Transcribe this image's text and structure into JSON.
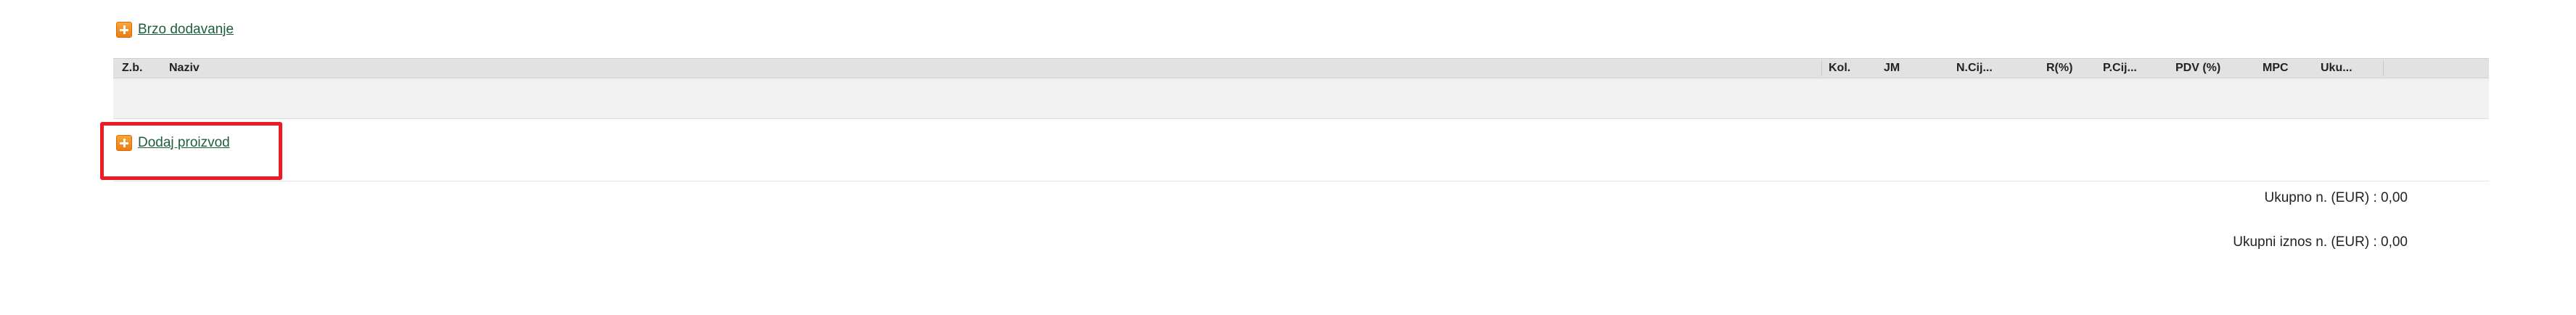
{
  "quick_add": {
    "label": "Brzo dodavanje",
    "icon": "plus-icon"
  },
  "table": {
    "columns": [
      "Z.b.",
      "Naziv",
      "Kol.",
      "JM",
      "N.Cij...",
      "R(%)",
      "P.Cij...",
      "PDV (%)",
      "MPC",
      "Uku..."
    ],
    "rows": []
  },
  "add_product": {
    "label": "Dodaj proizvod",
    "icon": "plus-icon"
  },
  "totals": {
    "net_total": "Ukupno n. (EUR) :  0,00",
    "grand_total": "Ukupni iznos n. (EUR) :  0,00"
  },
  "colors": {
    "link": "#1f5e3b",
    "icon_orange": "#ec7d12",
    "highlight": "#ec1c24",
    "header_bg": "#e2e2e2"
  }
}
